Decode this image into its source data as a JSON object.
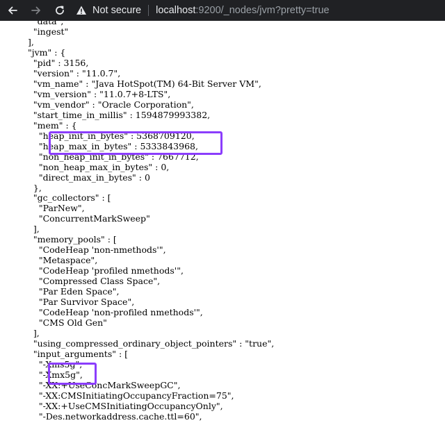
{
  "browser": {
    "security_label": "Not secure",
    "url_host": "localhost",
    "url_rest": ":9200/_nodes/jvm?pretty=true"
  },
  "highlight_color": "#8b3dfc",
  "json_lines": [
    "    \"data\",",
    "    \"ingest\"",
    "  ],",
    "  \"jvm\" : {",
    "    \"pid\" : 3156,",
    "    \"version\" : \"11.0.7\",",
    "    \"vm_name\" : \"Java HotSpot(TM) 64-Bit Server VM\",",
    "    \"vm_version\" : \"11.0.7+8-LTS\",",
    "    \"vm_vendor\" : \"Oracle Corporation\",",
    "    \"start_time_in_millis\" : 1594879993382,",
    "    \"mem\" : {",
    "      \"heap_init_in_bytes\" : 5368709120,",
    "      \"heap_max_in_bytes\" : 5333843968,",
    "      \"non_heap_init_in_bytes\" : 7667712,",
    "      \"non_heap_max_in_bytes\" : 0,",
    "      \"direct_max_in_bytes\" : 0",
    "    },",
    "    \"gc_collectors\" : [",
    "      \"ParNew\",",
    "      \"ConcurrentMarkSweep\"",
    "    ],",
    "    \"memory_pools\" : [",
    "      \"CodeHeap 'non-nmethods'\",",
    "      \"Metaspace\",",
    "      \"CodeHeap 'profiled nmethods'\",",
    "      \"Compressed Class Space\",",
    "      \"Par Eden Space\",",
    "      \"Par Survivor Space\",",
    "      \"CodeHeap 'non-profiled nmethods'\",",
    "      \"CMS Old Gen\"",
    "    ],",
    "    \"using_compressed_ordinary_object_pointers\" : \"true\",",
    "    \"input_arguments\" : [",
    "      \"-Xms5g\",",
    "      \"-Xmx5g\",",
    "      \"-XX:+UseConcMarkSweepGC\",",
    "      \"-XX:CMSInitiatingOccupancyFraction=75\",",
    "      \"-XX:+UseCMSInitiatingOccupancyOnly\",",
    "      \"-Des.networkaddress.cache.ttl=60\","
  ]
}
